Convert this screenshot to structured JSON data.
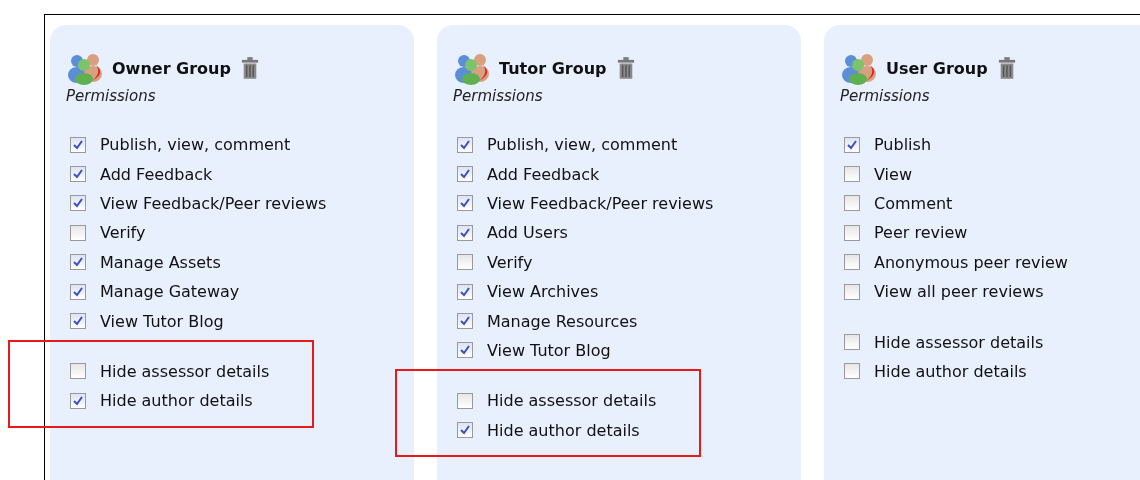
{
  "groups": [
    {
      "name": "Owner Group",
      "subtitle": "Permissions",
      "sections": [
        {
          "highlighted": false,
          "options": [
            {
              "label": "Publish, view, comment",
              "checked": true
            },
            {
              "label": "Add Feedback",
              "checked": true
            },
            {
              "label": "View Feedback/Peer reviews",
              "checked": true
            },
            {
              "label": "Verify",
              "checked": false
            },
            {
              "label": "Manage Assets",
              "checked": true
            },
            {
              "label": "Manage Gateway",
              "checked": true
            },
            {
              "label": "View Tutor Blog",
              "checked": true
            }
          ]
        },
        {
          "highlighted": true,
          "options": [
            {
              "label": "Hide assessor details",
              "checked": false
            },
            {
              "label": "Hide author details",
              "checked": true
            }
          ]
        }
      ]
    },
    {
      "name": "Tutor Group",
      "subtitle": "Permissions",
      "sections": [
        {
          "highlighted": false,
          "options": [
            {
              "label": "Publish, view, comment",
              "checked": true
            },
            {
              "label": "Add Feedback",
              "checked": true
            },
            {
              "label": "View Feedback/Peer reviews",
              "checked": true
            },
            {
              "label": "Add Users",
              "checked": true
            },
            {
              "label": "Verify",
              "checked": false
            },
            {
              "label": "View Archives",
              "checked": true
            },
            {
              "label": "Manage Resources",
              "checked": true
            },
            {
              "label": "View Tutor Blog",
              "checked": true
            }
          ]
        },
        {
          "highlighted": true,
          "options": [
            {
              "label": "Hide assessor details",
              "checked": false
            },
            {
              "label": "Hide author details",
              "checked": true
            }
          ]
        }
      ]
    },
    {
      "name": "User Group",
      "subtitle": "Permissions",
      "sections": [
        {
          "highlighted": false,
          "options": [
            {
              "label": "Publish",
              "checked": true
            },
            {
              "label": "View",
              "checked": false
            },
            {
              "label": "Comment",
              "checked": false
            },
            {
              "label": "Peer review",
              "checked": false
            },
            {
              "label": "Anonymous peer review",
              "checked": false
            },
            {
              "label": "View all peer reviews",
              "checked": false
            }
          ]
        },
        {
          "highlighted": false,
          "options": [
            {
              "label": "Hide assessor details",
              "checked": false
            },
            {
              "label": "Hide author details",
              "checked": false
            }
          ]
        }
      ]
    }
  ]
}
